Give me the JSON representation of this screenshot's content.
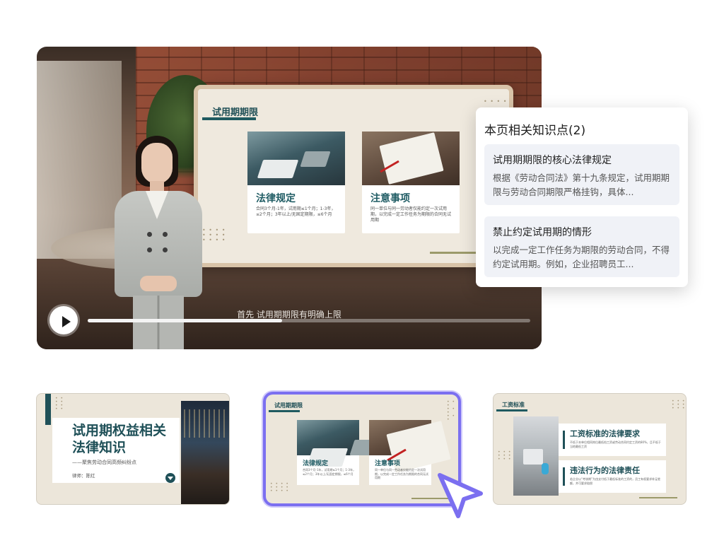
{
  "video": {
    "slide": {
      "title": "试用期期限",
      "cards": [
        {
          "title": "法律规定",
          "text": "合同3个月-1年，试用期≤1个月；1-3年，≤2个月；3年以上/无固定期限，≤6个月"
        },
        {
          "title": "注意事项",
          "text": "同一单位与同一劳动者仅能约定一次试用期，以完成一定工作任务为期限的合同无试用期"
        }
      ]
    },
    "subtitle": "首先 试用期期限有明确上限",
    "progress": 0.44
  },
  "knowledge_panel": {
    "title": "本页相关知识点(2)",
    "items": [
      {
        "title": "试用期期限的核心法律规定",
        "desc": "根据《劳动合同法》第十九条规定，试用期期限与劳动合同期限严格挂钩，具体..."
      },
      {
        "title": "禁止约定试用期的情形",
        "desc": "以完成一定工作任务为期限的劳动合同，不得约定试用期。例如，企业招聘员工..."
      }
    ]
  },
  "thumbnails": [
    {
      "title": "试用期权益相关法律知识",
      "subtitle": "——聚焦劳动合同高频纠纷点",
      "author": "律师：陈红"
    },
    {
      "label": "试用期期限",
      "cards": [
        {
          "title": "法律规定",
          "text": "合同3个月-1年，试用期≤1个月；1-3年，≤2个月；3年以上/无固定期限，≤6个月"
        },
        {
          "title": "注意事项",
          "text": "同一单位与同一劳动者仅能约定一次试用期，以完成一定工作任务为期限的合同无试用期"
        }
      ]
    },
    {
      "label": "工资标准",
      "boxes": [
        {
          "title": "工资标准的法律要求",
          "text": "不低于本单位相同岗位最低档工资或劳动合同约定工资的80%，且不低于当地最低工资"
        },
        {
          "title": "违法行为的法律责任",
          "text": "若企业以“考核期”为由支付低于最低标准的工资的，员工有权要求补足差额，并可要求赔偿"
        }
      ]
    }
  ],
  "colors": {
    "accent": "#7b6ff0",
    "teal": "#1f5058",
    "panel_item_bg": "#f0f2f7"
  }
}
